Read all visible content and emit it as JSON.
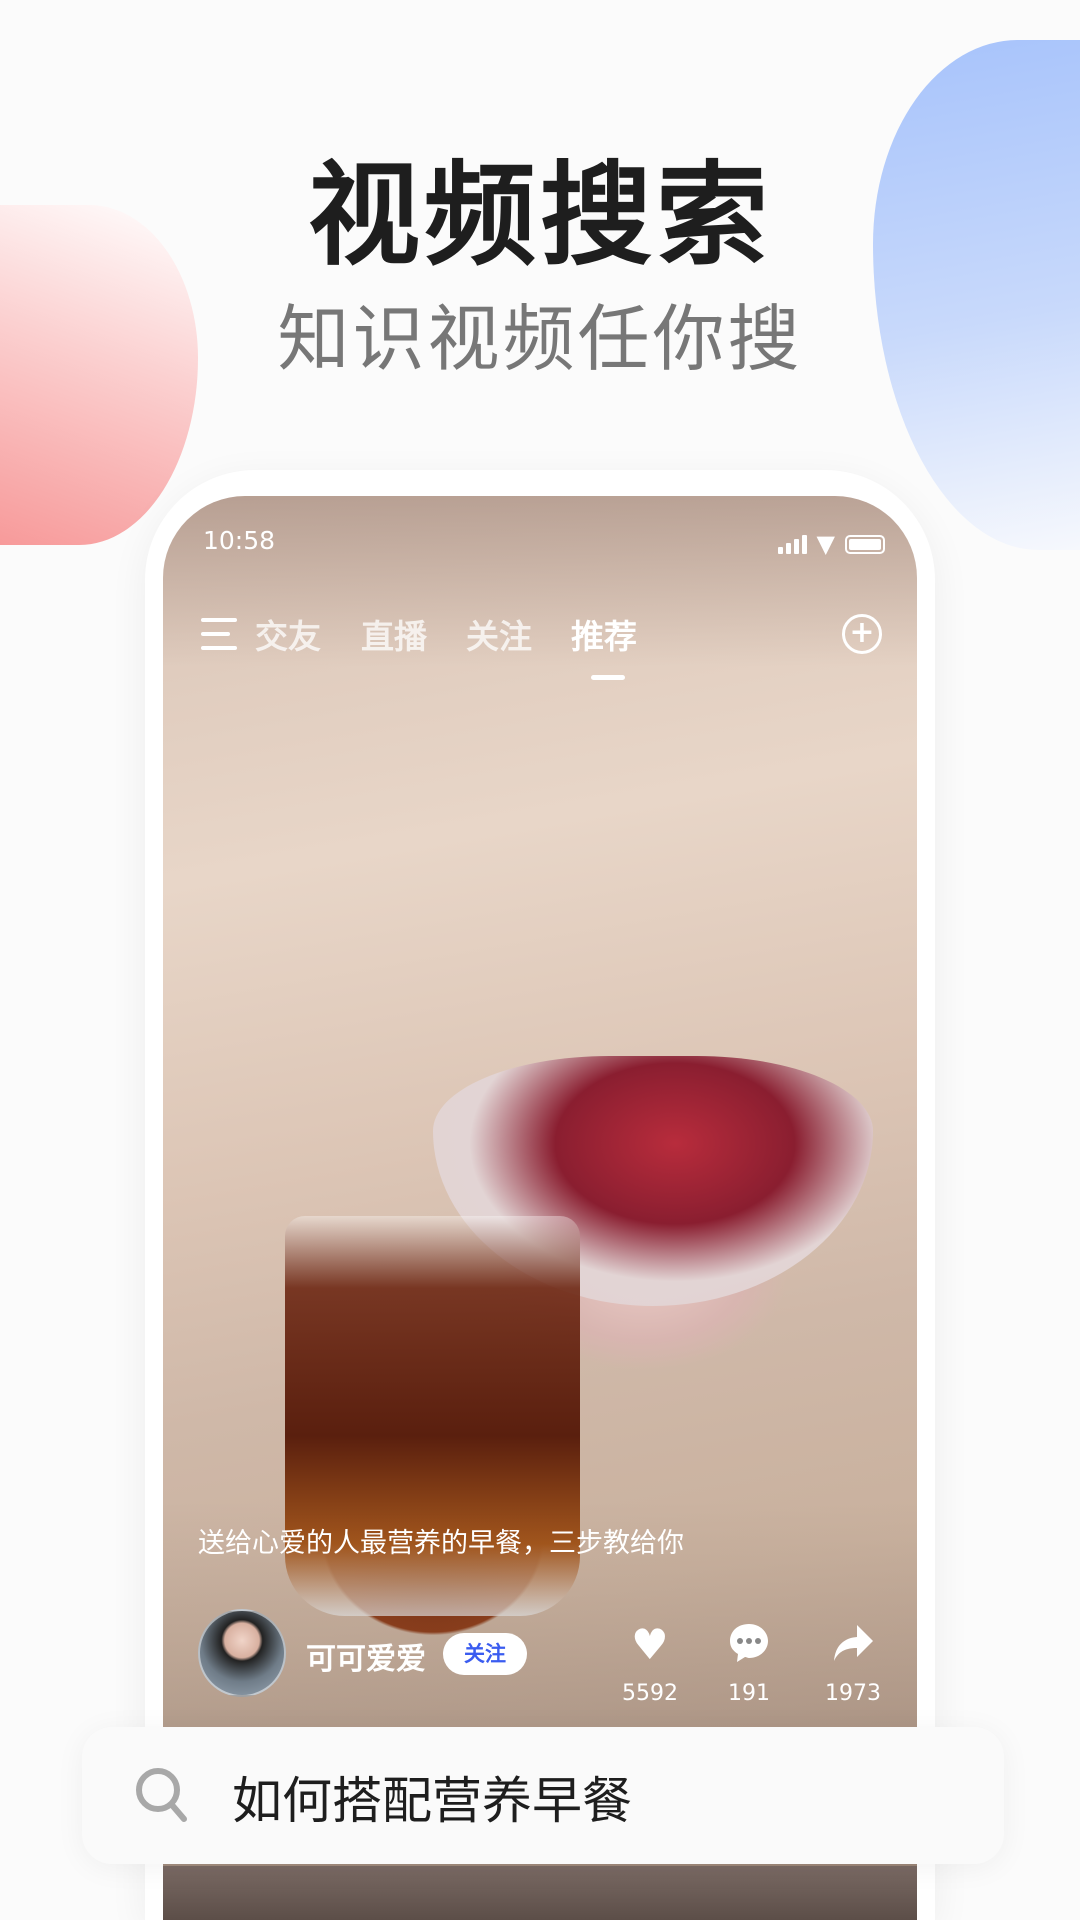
{
  "hero": {
    "title": "视频搜索",
    "subtitle": "知识视频任你搜"
  },
  "status_bar": {
    "time": "10:58"
  },
  "nav": {
    "tabs": [
      {
        "label": "交友"
      },
      {
        "label": "直播"
      },
      {
        "label": "关注"
      },
      {
        "label": "推荐",
        "active": true
      }
    ]
  },
  "video": {
    "caption": "送给心爱的人最营养的早餐，三步教给你",
    "author": "可可爱爱",
    "follow_label": "关注",
    "likes": "5592",
    "comments": "191",
    "shares": "1973"
  },
  "search": {
    "query": "如何搭配营养早餐"
  },
  "colors": {
    "accent": "#3a5cf0",
    "title": "#1e1e1e",
    "subtitle": "#777777"
  }
}
